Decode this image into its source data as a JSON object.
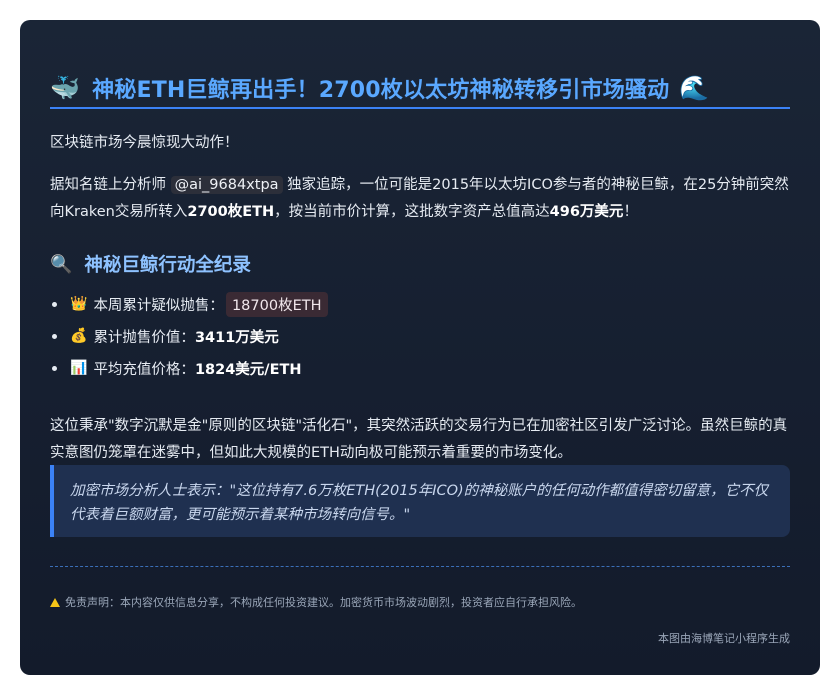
{
  "header": {
    "title_emoji": "🐳",
    "title": "神秘ETH巨鲸再出手！2700枚以太坊神秘转移引市场骚动",
    "title_emoji_right": "🌊"
  },
  "intro": "区块链市场今晨惊现大动作！",
  "story": {
    "prefix": "据知名链上分析师",
    "analyst": "@ai_9684xtpa",
    "middle": "独家追踪，一位可能是2015年以太坊ICO参与者的神秘巨鲸，在25分钟前突然向Kraken交易所转入",
    "amount": "2700枚ETH",
    "middle2": "，按当前市价计算，这批数字资产总值高达",
    "total": "496万美元",
    "suffix": "！"
  },
  "section": {
    "emoji": "🔍",
    "title": "神秘巨鲸行动全纪录"
  },
  "stats": [
    {
      "emoji": "👑",
      "label": "本周累计疑似抛售：",
      "value": "18700枚ETH"
    },
    {
      "emoji": "💰",
      "label": "累计抛售价值：",
      "value": "3411万美元"
    },
    {
      "emoji": "📊",
      "label": "平均充值价格：",
      "value": "1824美元/ETH"
    }
  ],
  "closing": "这位秉承\"数字沉默是金\"原则的区块链\"活化石\"，其突然活跃的交易行为已在加密社区引发广泛讨论。虽然巨鲸的真实意图仍笼罩在迷雾中，但如此大规模的ETH动向极可能预示着重要的市场变化。",
  "quote": "加密市场分析人士表示：\"这位持有7.6万枚ETH(2015年ICO)的神秘账户的任何动作都值得密切留意，它不仅代表着巨额财富，更可能预示着某种市场转向信号。\"",
  "disclaimer": "免责声明：本内容仅供信息分享，不构成任何投资建议。加密货币市场波动剧烈，投资者应自行承担风险。",
  "footer": "本图由海博笔记小程序生成",
  "colors": {
    "card_bg": "#161f30",
    "title": "#5aa8ff",
    "accent": "#3b82f6",
    "section_title": "#8ec2ff",
    "quote_bg": "#1f3050"
  }
}
